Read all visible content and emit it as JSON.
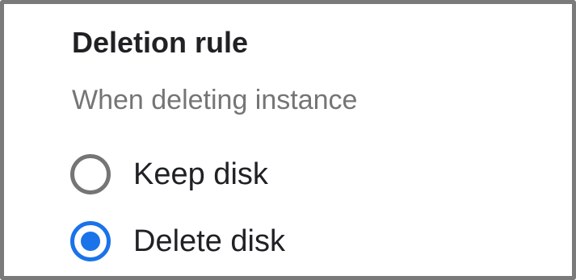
{
  "section": {
    "title": "Deletion rule",
    "subtitle": "When deleting instance"
  },
  "options": [
    {
      "label": "Keep disk",
      "selected": false
    },
    {
      "label": "Delete disk",
      "selected": true
    }
  ],
  "colors": {
    "accent": "#1a73e8",
    "unselected_radio": "#757575",
    "text_primary": "#202124",
    "text_secondary": "#757575",
    "frame_border": "#7a7a7a"
  },
  "icons": {
    "unselected": "radio-unchecked-icon",
    "selected": "radio-checked-icon"
  }
}
